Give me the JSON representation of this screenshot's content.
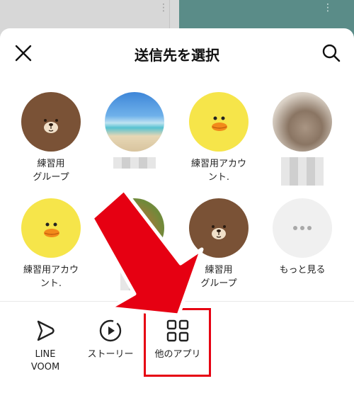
{
  "background": {
    "more_icon_left": "⋮",
    "more_icon_right": "⋮"
  },
  "header": {
    "title": "送信先を選択",
    "close_icon": "close-icon",
    "search_icon": "search-icon"
  },
  "contacts": [
    {
      "label": "練習用\nグループ",
      "avatar": "brown-bear"
    },
    {
      "label": "",
      "avatar": "beach-photo",
      "blurred": true
    },
    {
      "label": "練習用アカウ\nント.",
      "avatar": "yellow-chick"
    },
    {
      "label": "",
      "avatar": "cat-photo",
      "blurred": true
    },
    {
      "label": "練習用アカウ\nント.",
      "avatar": "yellow-chick"
    },
    {
      "label": "",
      "avatar": "food-photo",
      "blurred": true
    },
    {
      "label": "練習用\nグループ",
      "avatar": "brown-bear"
    },
    {
      "label": "もっと見る",
      "avatar": "more-dots"
    }
  ],
  "actions": [
    {
      "label": "LINE\nVOOM",
      "icon": "line-voom-icon"
    },
    {
      "label": "ストーリー",
      "icon": "story-icon"
    },
    {
      "label": "他のアプリ",
      "icon": "other-apps-icon"
    }
  ],
  "colors": {
    "accent_red": "#e60012",
    "bear_brown": "#7a5236",
    "chick_yellow": "#f6e54a"
  }
}
